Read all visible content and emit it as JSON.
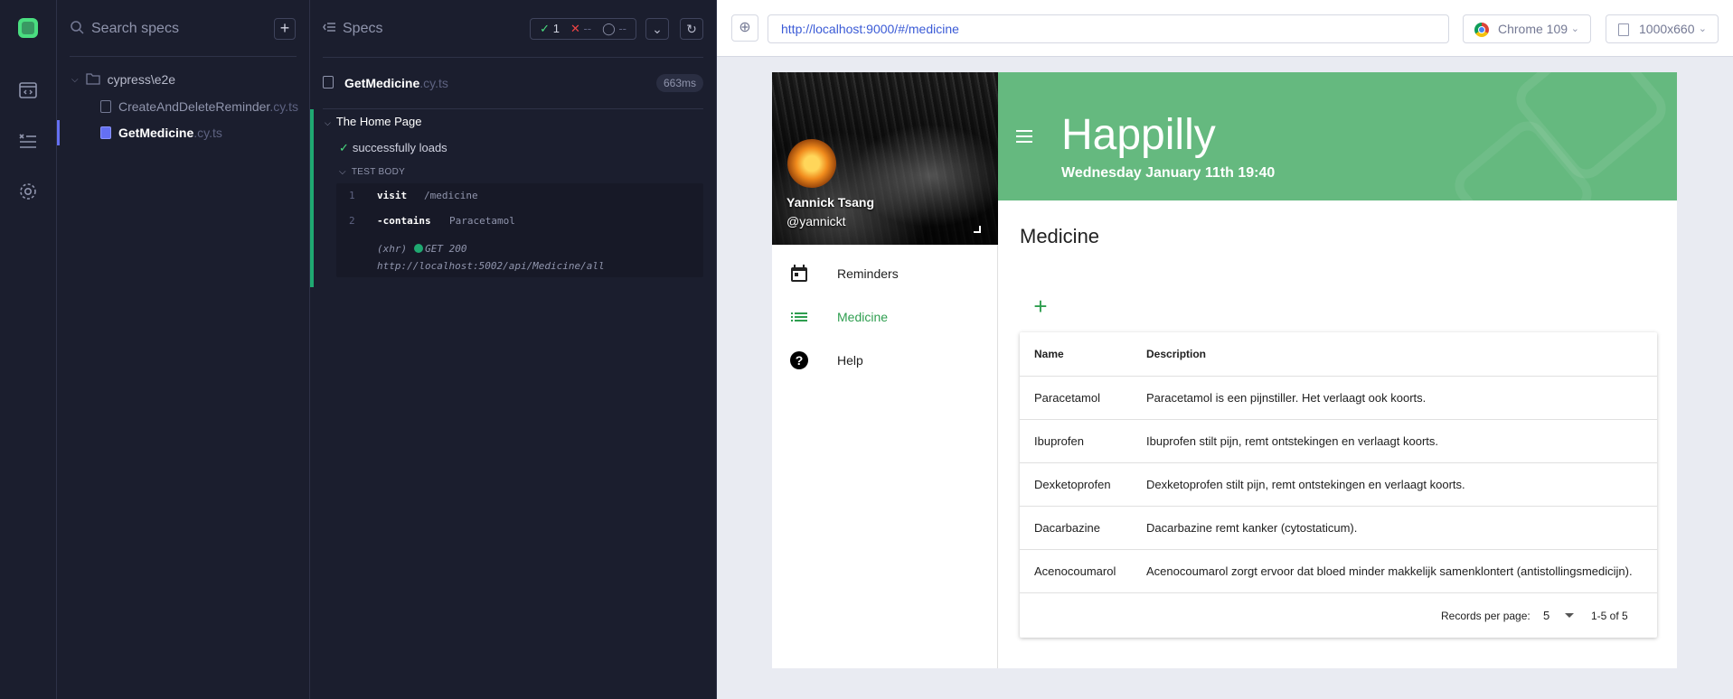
{
  "rail": {
    "icons": [
      "cypress-logo-icon",
      "specs-icon",
      "runs-icon",
      "settings-icon"
    ]
  },
  "speclist": {
    "search_placeholder": "Search specs",
    "add_label": "+",
    "folder": "cypress\\e2e",
    "files": [
      {
        "name": "CreateAndDeleteReminder",
        "ext": ".cy.ts",
        "active": false
      },
      {
        "name": "GetMedicine",
        "ext": ".cy.ts",
        "active": true
      }
    ]
  },
  "reporter": {
    "title": "Specs",
    "stats": {
      "passed": "1",
      "failed": "--",
      "pending": "--"
    },
    "spec": {
      "name": "GetMedicine",
      "ext": ".cy.ts",
      "duration": "663ms"
    },
    "suite": "The Home Page",
    "test": "successfully loads",
    "body_label": "TEST BODY",
    "commands": [
      {
        "num": "1",
        "name": "visit",
        "arg": "/medicine"
      },
      {
        "num": "2",
        "name": "-contains",
        "arg": "Paracetamol"
      }
    ],
    "xhr": {
      "tag": "(xhr)",
      "status": "GET 200",
      "url": "http://localhost:5002/api/Medicine/all"
    }
  },
  "aut_bar": {
    "url": "http://localhost:9000/#/medicine",
    "browser": "Chrome 109",
    "viewport": "1000x660"
  },
  "app": {
    "user": {
      "name": "Yannick Tsang",
      "handle": "@yannickt"
    },
    "nav": [
      {
        "label": "Reminders",
        "icon": "calendar-icon",
        "active": false
      },
      {
        "label": "Medicine",
        "icon": "list-icon",
        "active": true
      },
      {
        "label": "Help",
        "icon": "help-icon",
        "active": false
      }
    ],
    "title": "Happilly",
    "date": "Wednesday January 11th 19:40",
    "page_title": "Medicine",
    "add_label": "+",
    "colors": {
      "primary": "#65b97f",
      "accent": "#2e9e4f"
    },
    "table": {
      "headers": {
        "name": "Name",
        "description": "Description"
      },
      "rows": [
        {
          "name": "Paracetamol",
          "description": "Paracetamol is een pijnstiller. Het verlaagt ook koorts."
        },
        {
          "name": "Ibuprofen",
          "description": "Ibuprofen stilt pijn, remt ontstekingen en verlaagt koorts."
        },
        {
          "name": "Dexketoprofen",
          "description": "Dexketoprofen stilt pijn, remt ontstekingen en verlaagt koorts."
        },
        {
          "name": "Dacarbazine",
          "description": "Dacarbazine remt kanker (cytostaticum)."
        },
        {
          "name": "Acenocoumarol",
          "description": "Acenocoumarol zorgt ervoor dat bloed minder makkelijk samenklontert (antistollingsmedicijn)."
        }
      ],
      "records_per_page_label": "Records per page:",
      "records_per_page": "5",
      "range": "1-5 of 5"
    }
  }
}
